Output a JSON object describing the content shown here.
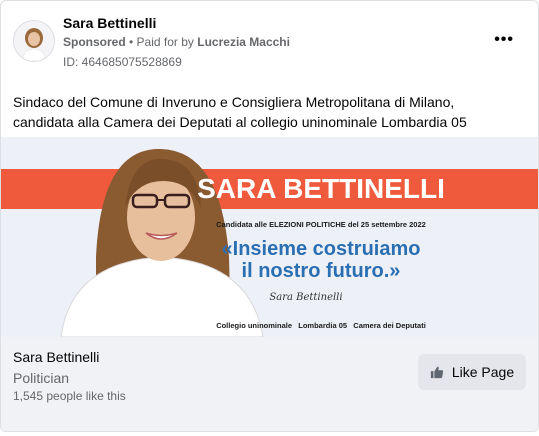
{
  "post": {
    "page_name": "Sara Bettinelli",
    "sponsored": "Sponsored",
    "paid_for_prefix": "• Paid for by",
    "payer": "Lucrezia Macchi",
    "ad_id": "ID: 464685075528869",
    "more_icon": "more-horizontal-icon",
    "text": "Sindaco del Comune di Inveruno e Consigliera Metropolitana di Milano, candidata alla Camera dei Deputati al collegio uninominale Lombardia 05"
  },
  "banner": {
    "name": "SARA BETTINELLI",
    "candidacy": "Candidata alle ELEZIONI POLITICHE del 25 settembre 2022",
    "slogan_line1": "«Insieme costruiamo",
    "slogan_line2": "il nostro futuro.»",
    "signature": "Sara Bettinelli",
    "footer_line": "Collegio uninominale   Lombardia 05   Camera dei Deputati",
    "colors": {
      "stripe": "#f05a3c",
      "slogan": "#2b6fb3",
      "text": "#1a1a1a",
      "bg": "#eef0f8"
    }
  },
  "footer": {
    "name": "Sara Bettinelli",
    "category": "Politician",
    "likes": "1,545 people like this",
    "like_button": "Like Page",
    "like_icon": "thumbs-up-icon"
  }
}
